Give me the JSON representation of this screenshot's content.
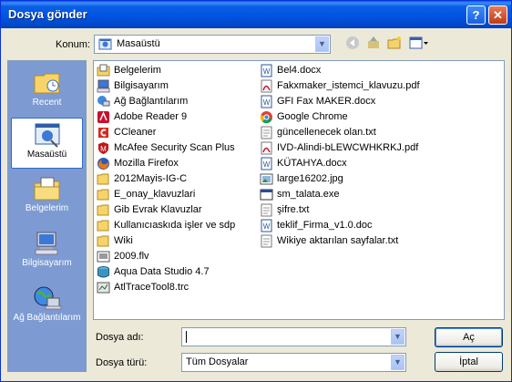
{
  "window": {
    "title": "Dosya gönder",
    "help_glyph": "?",
    "close_glyph": "✕"
  },
  "lookin": {
    "label": "Konum:",
    "value": "Masaüstü"
  },
  "places": [
    {
      "label": "Recent",
      "icon": "recent-folder-icon"
    },
    {
      "label": "Masaüstü",
      "icon": "desktop-icon",
      "selected": true
    },
    {
      "label": "Belgelerim",
      "icon": "my-documents-icon"
    },
    {
      "label": "Bilgisayarım",
      "icon": "my-computer-icon"
    },
    {
      "label": "Ağ Bağlantılarım",
      "icon": "network-places-icon"
    }
  ],
  "files_col1": [
    {
      "name": "Belgelerim",
      "icon": "my-documents-icon"
    },
    {
      "name": "Bilgisayarım",
      "icon": "my-computer-icon"
    },
    {
      "name": "Ağ Bağlantılarım",
      "icon": "network-places-icon"
    },
    {
      "name": "Adobe Reader 9",
      "icon": "adobe-reader-icon"
    },
    {
      "name": "CCleaner",
      "icon": "ccleaner-icon"
    },
    {
      "name": "McAfee Security Scan Plus",
      "icon": "mcafee-icon"
    },
    {
      "name": "Mozilla Firefox",
      "icon": "firefox-icon"
    },
    {
      "name": "2012Mayis-IG-C",
      "icon": "folder-icon"
    },
    {
      "name": "E_onay_klavuzlari",
      "icon": "folder-icon"
    },
    {
      "name": "Gib Evrak Klavuzlar",
      "icon": "folder-icon"
    },
    {
      "name": "Kullanıcıaskıda işler ve sdp",
      "icon": "folder-icon"
    },
    {
      "name": "Wiki",
      "icon": "folder-icon"
    },
    {
      "name": "2009.flv",
      "icon": "video-file-icon"
    },
    {
      "name": "Aqua Data Studio 4.7",
      "icon": "aqua-data-studio-icon"
    },
    {
      "name": "AtlTraceTool8.trc",
      "icon": "trace-file-icon"
    }
  ],
  "files_col2": [
    {
      "name": "Bel4.docx",
      "icon": "word-doc-icon"
    },
    {
      "name": "Fakxmaker_istemci_klavuzu.pdf",
      "icon": "pdf-file-icon"
    },
    {
      "name": "GFI Fax MAKER.docx",
      "icon": "word-doc-icon"
    },
    {
      "name": "Google Chrome",
      "icon": "chrome-icon"
    },
    {
      "name": "güncellenecek olan.txt",
      "icon": "text-file-icon"
    },
    {
      "name": "IVD-Alindi-bLEWCWHKRKJ.pdf",
      "icon": "pdf-file-icon"
    },
    {
      "name": "KÜTAHYA.docx",
      "icon": "word-doc-icon"
    },
    {
      "name": "large16202.jpg",
      "icon": "image-file-icon"
    },
    {
      "name": "sm_talata.exe",
      "icon": "exe-file-icon"
    },
    {
      "name": "şifre.txt",
      "icon": "text-file-icon"
    },
    {
      "name": "teklif_Firma_v1.0.doc",
      "icon": "word-doc-icon"
    },
    {
      "name": "Wikiye aktarılan sayfalar.txt",
      "icon": "text-file-icon"
    }
  ],
  "filename": {
    "label": "Dosya adı:",
    "value": ""
  },
  "filetype": {
    "label": "Dosya türü:",
    "value": "Tüm Dosyalar"
  },
  "buttons": {
    "open": "Aç",
    "cancel": "İptal"
  }
}
